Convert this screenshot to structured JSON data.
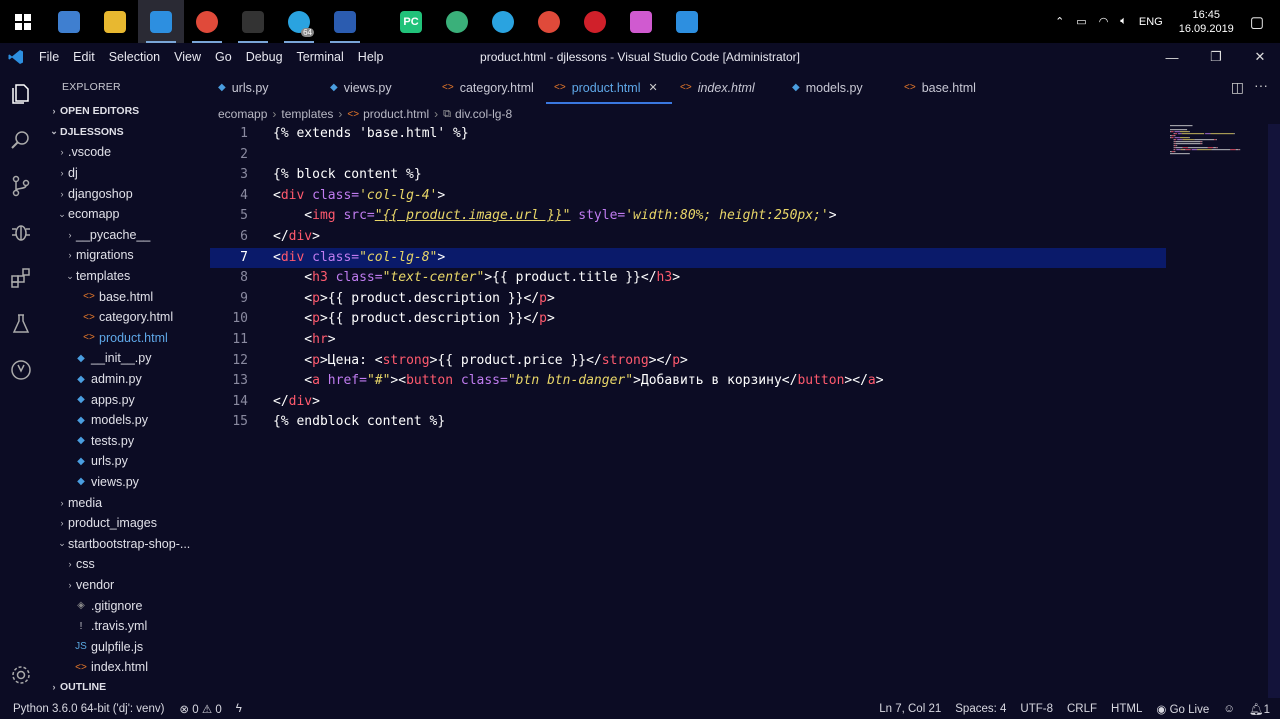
{
  "taskbar": {
    "apps": [
      {
        "name": "explorer-app",
        "icon": "computer-icon"
      },
      {
        "name": "files-app",
        "icon": "folder-icon"
      },
      {
        "name": "vscode-app",
        "icon": "vscode-icon"
      },
      {
        "name": "chrome-app",
        "icon": "chrome-icon"
      },
      {
        "name": "terminal-app",
        "icon": "terminal-icon"
      },
      {
        "name": "telegram-app",
        "icon": "telegram-icon",
        "badge": "64"
      },
      {
        "name": "word-app",
        "icon": "word-icon"
      },
      {
        "name": "pycharm-app",
        "icon": "pycharm-icon",
        "label": "PC"
      },
      {
        "name": "atom-app",
        "icon": "atom-icon"
      },
      {
        "name": "telegram-app-2",
        "icon": "telegram-icon"
      },
      {
        "name": "chrome-app-2",
        "icon": "chrome-icon"
      },
      {
        "name": "opera-app",
        "icon": "opera-icon"
      },
      {
        "name": "gem-app",
        "icon": "gem-icon"
      },
      {
        "name": "vscode-app-2",
        "icon": "vscode-icon"
      }
    ],
    "tray": {
      "lang": "ENG",
      "time": "16:45",
      "date": "16.09.2019"
    }
  },
  "titlebar": {
    "menu": [
      "File",
      "Edit",
      "Selection",
      "View",
      "Go",
      "Debug",
      "Terminal",
      "Help"
    ],
    "title": "product.html - djlessons - Visual Studio Code [Administrator]"
  },
  "sidebar": {
    "header": "EXPLORER",
    "open_editors": "OPEN EDITORS",
    "project": "DJLESSONS",
    "outline": "OUTLINE",
    "tree": [
      {
        "label": ".vscode",
        "depth": 1,
        "kind": "folder",
        "open": false
      },
      {
        "label": "dj",
        "depth": 1,
        "kind": "folder",
        "open": false
      },
      {
        "label": "djangoshop",
        "depth": 1,
        "kind": "folder",
        "open": false
      },
      {
        "label": "ecomapp",
        "depth": 1,
        "kind": "folder",
        "open": true
      },
      {
        "label": "__pycache__",
        "depth": 2,
        "kind": "folder",
        "open": false
      },
      {
        "label": "migrations",
        "depth": 2,
        "kind": "folder",
        "open": false
      },
      {
        "label": "templates",
        "depth": 2,
        "kind": "folder",
        "open": true
      },
      {
        "label": "base.html",
        "depth": 3,
        "kind": "html"
      },
      {
        "label": "category.html",
        "depth": 3,
        "kind": "html"
      },
      {
        "label": "product.html",
        "depth": 3,
        "kind": "html",
        "active": true
      },
      {
        "label": "__init__.py",
        "depth": 2,
        "kind": "py"
      },
      {
        "label": "admin.py",
        "depth": 2,
        "kind": "py"
      },
      {
        "label": "apps.py",
        "depth": 2,
        "kind": "py"
      },
      {
        "label": "models.py",
        "depth": 2,
        "kind": "py"
      },
      {
        "label": "tests.py",
        "depth": 2,
        "kind": "py"
      },
      {
        "label": "urls.py",
        "depth": 2,
        "kind": "py"
      },
      {
        "label": "views.py",
        "depth": 2,
        "kind": "py"
      },
      {
        "label": "media",
        "depth": 1,
        "kind": "folder",
        "open": false
      },
      {
        "label": "product_images",
        "depth": 1,
        "kind": "folder",
        "open": false
      },
      {
        "label": "startbootstrap-shop-...",
        "depth": 1,
        "kind": "folder",
        "open": true
      },
      {
        "label": "css",
        "depth": 2,
        "kind": "folder",
        "open": false
      },
      {
        "label": "vendor",
        "depth": 2,
        "kind": "folder",
        "open": false
      },
      {
        "label": ".gitignore",
        "depth": 2,
        "kind": "git"
      },
      {
        "label": ".travis.yml",
        "depth": 2,
        "kind": "yml"
      },
      {
        "label": "gulpfile.js",
        "depth": 2,
        "kind": "js"
      },
      {
        "label": "index.html",
        "depth": 2,
        "kind": "html"
      }
    ]
  },
  "tabs": [
    {
      "label": "urls.py",
      "kind": "py"
    },
    {
      "label": "views.py",
      "kind": "py"
    },
    {
      "label": "category.html",
      "kind": "html"
    },
    {
      "label": "product.html",
      "kind": "html",
      "active": true
    },
    {
      "label": "index.html",
      "kind": "html",
      "italic": true
    },
    {
      "label": "models.py",
      "kind": "py"
    },
    {
      "label": "base.html",
      "kind": "html"
    }
  ],
  "breadcrumb": [
    "ecomapp",
    "templates",
    "product.html",
    "div.col-lg-8"
  ],
  "code": {
    "current_line": 7,
    "lines": [
      [
        [
          "b",
          "{% extends 'base.html' %}"
        ]
      ],
      [],
      [
        [
          "b",
          "{% block content %}"
        ]
      ],
      [
        [
          "b",
          "<"
        ],
        [
          "t",
          "div"
        ],
        [
          "a",
          " class="
        ],
        [
          "s",
          "'col-lg-4'"
        ],
        [
          "b",
          ">"
        ]
      ],
      [
        [
          "b",
          "    <"
        ],
        [
          "t",
          "img"
        ],
        [
          "a",
          " src="
        ],
        [
          "s",
          "\"{{ product.image.url }}\""
        ],
        [
          "a",
          " style="
        ],
        [
          "s",
          "'width:80%; height:250px;'"
        ],
        [
          "b",
          ">"
        ]
      ],
      [
        [
          "b",
          "</"
        ],
        [
          "t",
          "div"
        ],
        [
          "b",
          ">"
        ]
      ],
      [
        [
          "b",
          "<"
        ],
        [
          "t",
          "div"
        ],
        [
          "a",
          " class="
        ],
        [
          "s",
          "\"col-lg-8\""
        ],
        [
          "b",
          ">"
        ]
      ],
      [
        [
          "b",
          "    <"
        ],
        [
          "t",
          "h3"
        ],
        [
          "a",
          " class="
        ],
        [
          "s",
          "\"text-center\""
        ],
        [
          "b",
          ">{{ product.title }}</"
        ],
        [
          "t",
          "h3"
        ],
        [
          "b",
          ">"
        ]
      ],
      [
        [
          "b",
          "    <"
        ],
        [
          "t",
          "p"
        ],
        [
          "b",
          ">{{ product.description }}</"
        ],
        [
          "t",
          "p"
        ],
        [
          "b",
          ">"
        ]
      ],
      [
        [
          "b",
          "    <"
        ],
        [
          "t",
          "p"
        ],
        [
          "b",
          ">{{ product.description }}</"
        ],
        [
          "t",
          "p"
        ],
        [
          "b",
          ">"
        ]
      ],
      [
        [
          "b",
          "    <"
        ],
        [
          "t",
          "hr"
        ],
        [
          "b",
          ">"
        ]
      ],
      [
        [
          "b",
          "    <"
        ],
        [
          "t",
          "p"
        ],
        [
          "b",
          ">Цена: <"
        ],
        [
          "t",
          "strong"
        ],
        [
          "b",
          ">{{ product.price }}</"
        ],
        [
          "t",
          "strong"
        ],
        [
          "b",
          "></"
        ],
        [
          "t",
          "p"
        ],
        [
          "b",
          ">"
        ]
      ],
      [
        [
          "b",
          "    <"
        ],
        [
          "t",
          "a"
        ],
        [
          "a",
          " href="
        ],
        [
          "s",
          "\"#\""
        ],
        [
          "b",
          "><"
        ],
        [
          "t",
          "button"
        ],
        [
          "a",
          " class="
        ],
        [
          "s",
          "\"btn btn-danger\""
        ],
        [
          "b",
          ">Добавить в корзину</"
        ],
        [
          "t",
          "button"
        ],
        [
          "b",
          "></"
        ],
        [
          "t",
          "a"
        ],
        [
          "b",
          ">"
        ]
      ],
      [
        [
          "b",
          "</"
        ],
        [
          "t",
          "div"
        ],
        [
          "b",
          ">"
        ]
      ],
      [
        [
          "b",
          "{% endblock content %}"
        ]
      ]
    ]
  },
  "statusbar": {
    "python": "Python 3.6.0 64-bit ('dj': venv)",
    "errors": "0",
    "warnings": "0",
    "position": "Ln 7, Col 21",
    "spaces": "Spaces: 4",
    "encoding": "UTF-8",
    "eol": "CRLF",
    "language": "HTML",
    "golive": "Go Live",
    "bell_count": "1"
  },
  "colors": {
    "accent": "#3a78e0",
    "tag": "#ff5a6e",
    "attr": "#c07cf0",
    "string": "#e8d668",
    "bg": "#0c0c24",
    "current_line": "#0a1a6a"
  }
}
